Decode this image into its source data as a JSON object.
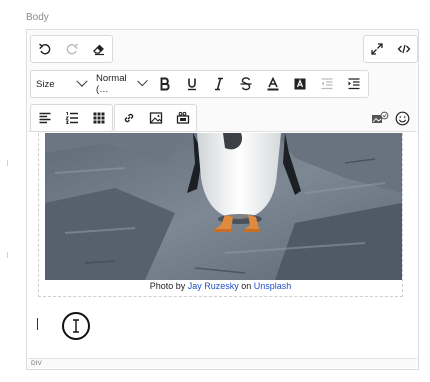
{
  "field": {
    "label": "Body"
  },
  "toolbar": {
    "size_select": "Size",
    "format_select": "Normal (…",
    "buttons": [
      "undo",
      "redo",
      "clear-formatting",
      "fullscreen",
      "source-code",
      "bold",
      "underline",
      "italic",
      "strikethrough",
      "font-color",
      "highlight-color",
      "outdent",
      "indent",
      "align",
      "ordered-list",
      "table",
      "link",
      "image",
      "media",
      "embed",
      "emoji"
    ]
  },
  "content": {
    "caption_prefix": "Photo by ",
    "caption_author": "Jay Ruzesky",
    "caption_middle": " on ",
    "caption_source": "Unsplash"
  },
  "statusbar": {
    "path": "DIV"
  },
  "colors": {
    "link": "#2050c8",
    "border": "#dcdcdc",
    "toolbar_bg": "#fafafa"
  }
}
